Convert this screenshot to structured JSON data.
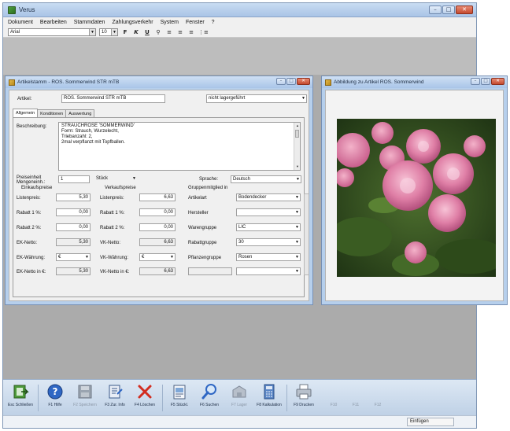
{
  "app": {
    "title": "Verus"
  },
  "menu": [
    "Dokument",
    "Bearbeiten",
    "Stammdaten",
    "Zahlungsverkehr",
    "System",
    "Fenster",
    "?"
  ],
  "format_toolbar": {
    "font": "Arial",
    "size": "10",
    "bold": "F",
    "italic": "K",
    "underline": "U"
  },
  "article_window": {
    "title": "Artikelstamm - ROS. Sommerwind STR mTB",
    "artikel_label": "Artikel:",
    "artikel_value": "ROS. Sommerwind STR mTB",
    "lager_status": "nicht lagergeführt",
    "tabs": [
      "Allgemein",
      "Konditionen",
      "Auswertung"
    ],
    "beschreibung_label": "Beschreibung:",
    "beschreibung_lines": [
      "STRAUCHROSE 'SOMMERWIND'",
      "Form: Strauch, Wurzelecht,",
      "Triebanzahl: 2,",
      "2mal verpflanzt mit Topfballen."
    ],
    "preiseinheit_label": "Preiseinheit\nMengeneinh.:",
    "preiseinheit_value": "1",
    "einheit": "Stück",
    "sprache_label": "Sprache:",
    "sprache_value": "Deutsch",
    "einkauf": {
      "header": "Einkaufspreise",
      "rows": [
        {
          "label": "Listenpreis:",
          "value": "5,30"
        },
        {
          "label": "Rabatt 1 %:",
          "value": "0,00"
        },
        {
          "label": "Rabatt 2 %:",
          "value": "0,00"
        },
        {
          "label": "EK-Netto:",
          "value": "5,30"
        },
        {
          "label": "EK-Währung:",
          "value": "€"
        },
        {
          "label": "EK-Netto in €:",
          "value": "5,30"
        }
      ]
    },
    "verkauf": {
      "header": "Verkaufspreise",
      "rows": [
        {
          "label": "Listenpreis:",
          "value": "6,63"
        },
        {
          "label": "Rabatt 1 %:",
          "value": "0,00"
        },
        {
          "label": "Rabatt 2 %:",
          "value": "0,00"
        },
        {
          "label": "VK-Netto:",
          "value": "6,63"
        },
        {
          "label": "VK-Währung:",
          "value": "€"
        },
        {
          "label": "VK-Netto in €:",
          "value": "6,63"
        }
      ]
    },
    "gruppen": {
      "header": "Gruppenmitglied in",
      "rows": [
        {
          "label": "Artikelart",
          "value": "Bodendecker"
        },
        {
          "label": "Hersteller",
          "value": ""
        },
        {
          "label": "Warengruppe",
          "value": "LIC"
        },
        {
          "label": "Rabattgruppe",
          "value": "30"
        },
        {
          "label": "Pflanzengruppe",
          "value": "Rosen"
        },
        {
          "label": "",
          "value": ""
        }
      ]
    }
  },
  "image_window": {
    "title": "Abbildung zu Artikel ROS. Sommerwind"
  },
  "bottom_toolbar": [
    {
      "label": "Esc Schließen",
      "icon": "exit-icon",
      "enabled": true
    },
    {
      "label": "F1 Hilfe",
      "icon": "help-icon",
      "enabled": true
    },
    {
      "label": "F2 Speichern",
      "icon": "save-icon",
      "enabled": false
    },
    {
      "label": "F3 Zur. Info",
      "icon": "info-icon",
      "enabled": true
    },
    {
      "label": "F4 Löschen",
      "icon": "delete-icon",
      "enabled": true
    },
    {
      "label": "F5 Stückl.",
      "icon": "parts-list-icon",
      "enabled": true
    },
    {
      "label": "F6 Suchen",
      "icon": "search-icon",
      "enabled": true
    },
    {
      "label": "F7 Lager",
      "icon": "warehouse-icon",
      "enabled": false
    },
    {
      "label": "F8 Kalkulation",
      "icon": "calculation-icon",
      "enabled": true
    },
    {
      "label": "F9 Drucken",
      "icon": "print-icon",
      "enabled": true
    },
    {
      "label": "F10",
      "icon": "",
      "enabled": false
    },
    {
      "label": "F11",
      "icon": "",
      "enabled": false
    },
    {
      "label": "F12",
      "icon": "",
      "enabled": false
    }
  ],
  "status": {
    "mode": "Einfügen"
  },
  "colors": {
    "accent": "#b9d2ee",
    "workspace": "#ababab",
    "close": "#c44a2f"
  }
}
